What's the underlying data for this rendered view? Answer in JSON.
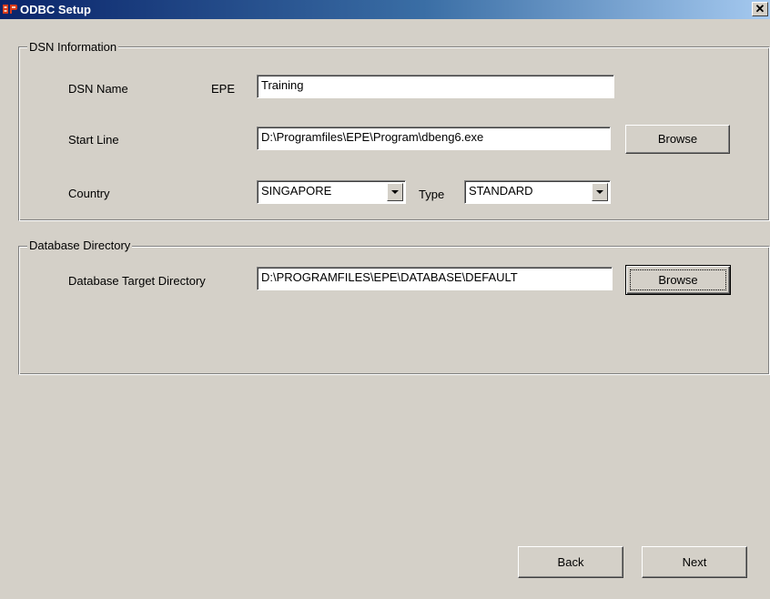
{
  "window": {
    "title": "ODBC Setup",
    "close_glyph": "✕"
  },
  "dsn_group": {
    "legend": "DSN Information",
    "dsn_name_label": "DSN Name",
    "prefix": "EPE",
    "dsn_name_value": "Training",
    "start_line_label": "Start Line",
    "start_line_value": "D:\\Programfiles\\EPE\\Program\\dbeng6.exe",
    "browse_label": "Browse",
    "country_label": "Country",
    "country_value": "SINGAPORE",
    "type_label": "Type",
    "type_value": "STANDARD"
  },
  "db_group": {
    "legend": "Database Directory",
    "target_label": "Database Target Directory",
    "target_value": "D:\\PROGRAMFILES\\EPE\\DATABASE\\DEFAULT",
    "browse_label": "Browse"
  },
  "buttons": {
    "back": "Back",
    "next": "Next"
  },
  "icons": {
    "app": "epe-logo-icon",
    "close": "close-icon",
    "dropdown": "chevron-down-icon"
  },
  "colors": {
    "titlebar_start": "#0a246a",
    "titlebar_end": "#a6caf0",
    "face": "#d4d0c8",
    "icon_red": "#d93a1a"
  }
}
